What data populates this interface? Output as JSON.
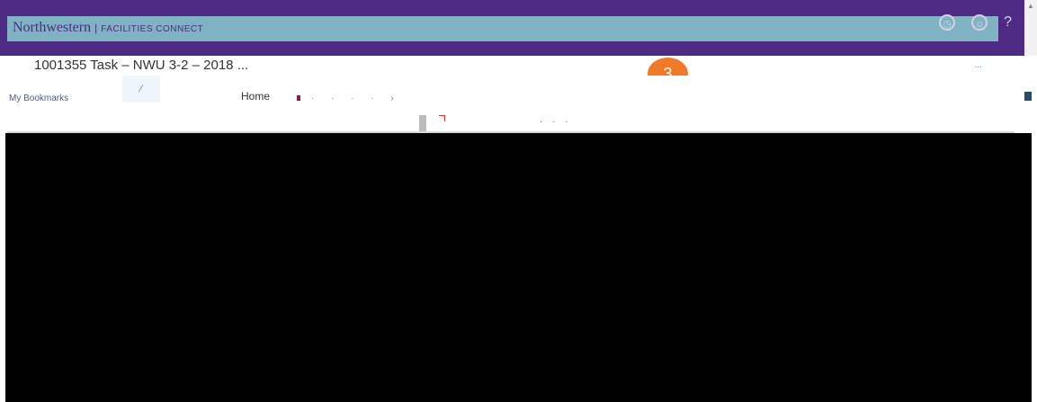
{
  "header": {
    "brand": "Northwestern",
    "brand_separator": "|",
    "brand_sub": "FACILITIES CONNECT",
    "icons": [
      "clock-icon",
      "user-icon",
      "help-icon"
    ]
  },
  "page": {
    "title": "1001355 Task – NWU 3-2 – 2018 ...",
    "title_right_text": "..."
  },
  "step_badge": {
    "number": "3",
    "color": "#f07a2a"
  },
  "bookmarks": {
    "label": "My Bookmarks",
    "home_label": "Home"
  },
  "colors": {
    "brand_purple": "#4e2a84",
    "teal_band": "#7fb3c4",
    "content": "#000000"
  }
}
